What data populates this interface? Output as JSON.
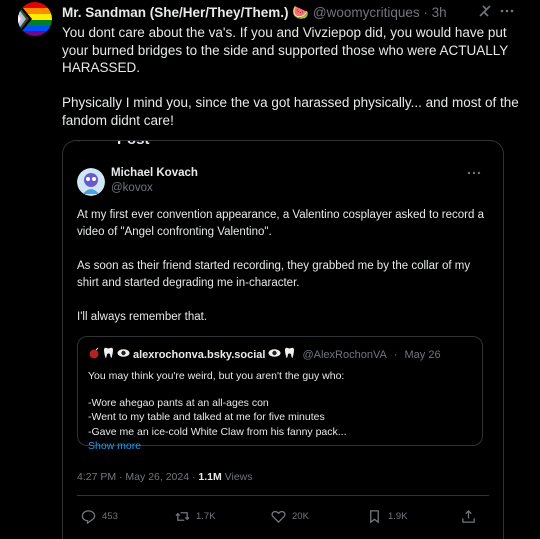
{
  "author": {
    "name": "Mr. Sandman (She/Her/They/Them.) 🍉",
    "handle": "@woomycritiques",
    "time": "3h"
  },
  "post": {
    "paragraph1": "You dont care about the va's. If you and Vivziepop did, you would have put your burned bridges to the side and supported those who were ACTUALLY HARASSED.",
    "paragraph2": "Physically I mind you, since the va got harassed physically... and most of the fandom didnt care!"
  },
  "quoted": {
    "header_label": "Post",
    "name": "Michael Kovach",
    "handle": "@kovox",
    "paragraph1": "At my first ever convention appearance, a Valentino cosplayer asked to record a video of \"Angel confronting Valentino\".",
    "paragraph2": "As soon as their friend started recording, they grabbed me by the collar of my shirt and started degrading me in-character.",
    "paragraph3": "I'll always remember that.",
    "inner": {
      "name": "alexrochonva.bsky.social",
      "handle": "@AlexRochonVA",
      "date": "May 26",
      "intro": "You may think you're weird, but you aren't the guy who:",
      "line1": "-Wore ahegao pants at an all-ages con",
      "line2": "-Went to my table and talked at me for five minutes",
      "line3": "-Gave me an ice-cold White Claw from his fanny pack...",
      "show_more": "Show more"
    },
    "meta": {
      "time": "4:27 PM · May 26, 2024 ·",
      "views_count": "1.1M",
      "views_label": "Views"
    },
    "actions": {
      "replies": "453",
      "reposts": "1.7K",
      "likes": "20K",
      "bookmarks": "1.9K"
    }
  },
  "icons": [
    "bomb-icon",
    "tooth-icon",
    "eye-icon",
    "more-icon",
    "grok-icon",
    "back-arrow-icon",
    "reply-icon",
    "repost-icon",
    "like-icon",
    "bookmark-icon",
    "share-icon"
  ]
}
